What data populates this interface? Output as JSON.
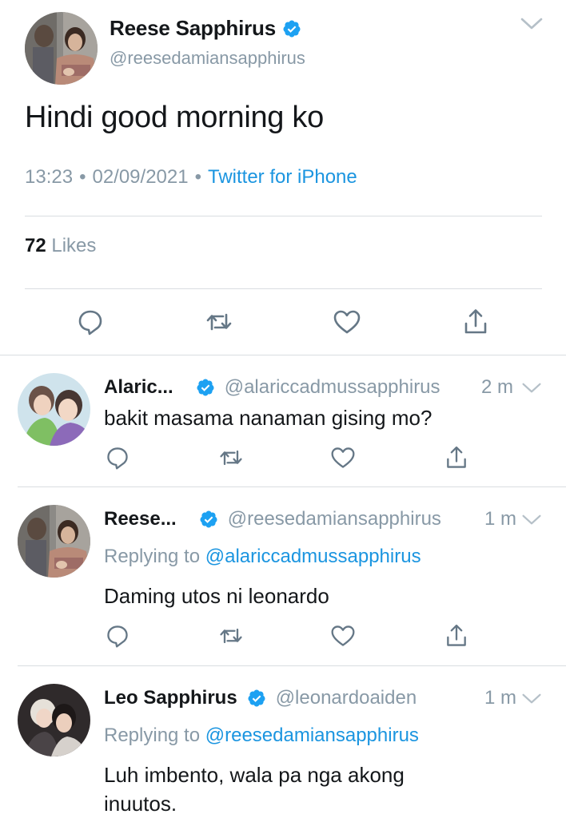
{
  "main_tweet": {
    "display_name": "Reese Sapphirus",
    "handle": "@reesedamiansapphirus",
    "text": "Hindi good morning ko",
    "time": "13:23",
    "date": "02/09/2021",
    "source": "Twitter for iPhone",
    "likes_count": "72",
    "likes_label": "Likes"
  },
  "replies": [
    {
      "display_name": "Alaric...",
      "handle": "@alariccadmussapphirus",
      "time": "2 m",
      "replying_prefix": "",
      "replying_to": "",
      "text": "bakit masama nanaman gising mo?"
    },
    {
      "display_name": "Reese...",
      "handle": "@reesedamiansapphirus",
      "time": "1 m",
      "replying_prefix": "Replying to",
      "replying_to": "@alariccadmussapphirus",
      "text": "Daming utos ni leonardo"
    },
    {
      "display_name": "Leo Sapphirus",
      "handle": "@leonardoaiden",
      "time": "1 m",
      "replying_prefix": "Replying to",
      "replying_to": "@reesedamiansapphirus",
      "text": "Luh imbento, wala pa nga akong inuutos."
    }
  ],
  "colors": {
    "text_primary": "#14171a",
    "text_secondary": "#8899a6",
    "link_blue": "#1b95e0",
    "verified_blue": "#1da1f2",
    "divider": "#d9dde1"
  },
  "icons": [
    "verified-badge-icon",
    "chevron-down-icon",
    "reply-icon",
    "retweet-icon",
    "like-icon",
    "share-icon"
  ]
}
